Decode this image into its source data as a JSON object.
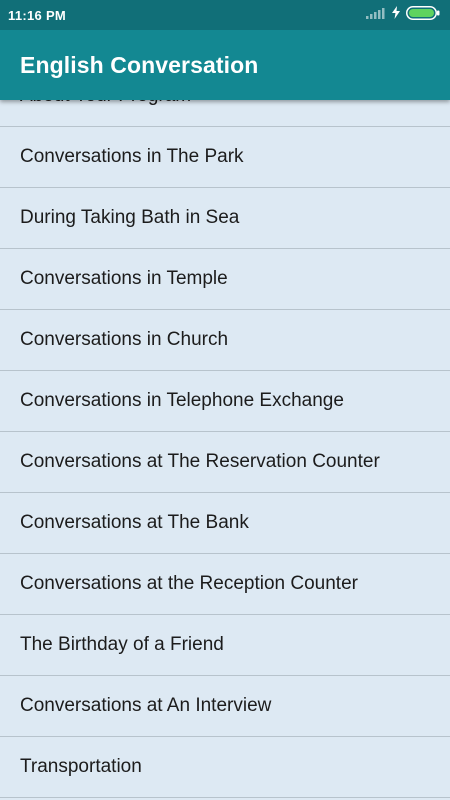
{
  "status_bar": {
    "time": "11:16 PM",
    "icons": [
      "signal-icon",
      "charging-icon",
      "battery-icon"
    ],
    "color": "#116f78"
  },
  "app_bar": {
    "title": "English Conversation",
    "color": "#138892"
  },
  "list": {
    "background": "#dde9f3",
    "items": [
      "About Your Program",
      "Conversations in The Park",
      "During Taking Bath in Sea",
      "Conversations in Temple",
      "Conversations in Church",
      "Conversations in Telephone Exchange",
      "Conversations at The Reservation Counter",
      "Conversations at The Bank",
      "Conversations at the Reception Counter",
      "The Birthday of a Friend",
      "Conversations at An Interview",
      "Transportation"
    ]
  }
}
